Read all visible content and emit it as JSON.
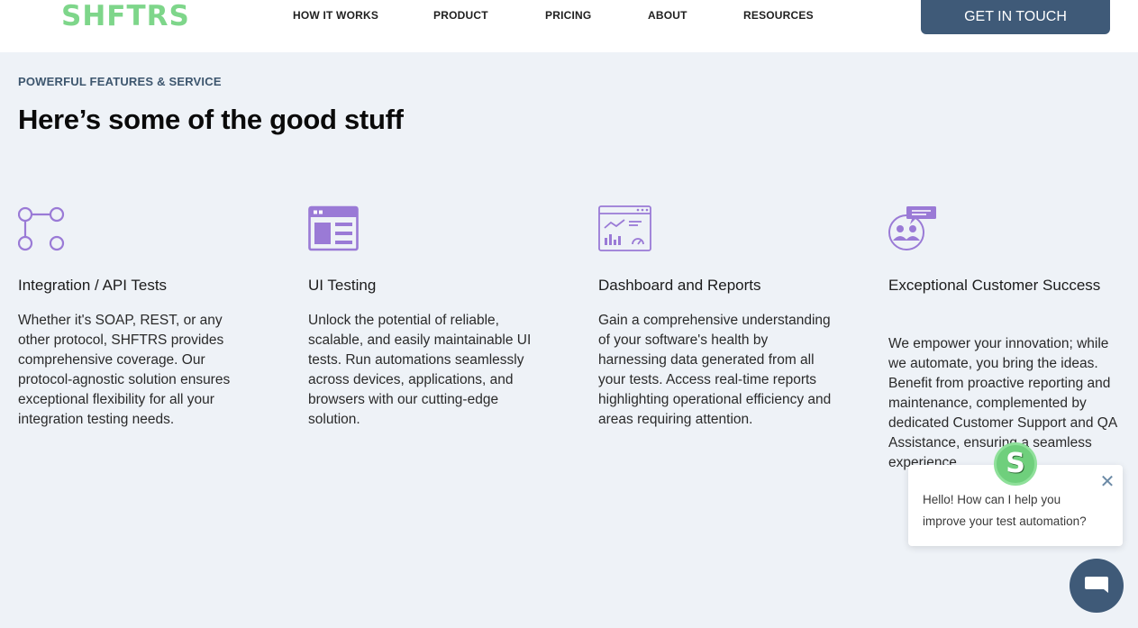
{
  "header": {
    "logo": "SHFTRS",
    "nav": [
      "HOW IT WORKS",
      "PRODUCT",
      "PRICING",
      "ABOUT",
      "RESOURCES"
    ],
    "cta": "GET IN TOUCH"
  },
  "section": {
    "eyebrow": "POWERFUL FEATURES & SERVICE",
    "headline": "Here’s some of the good stuff"
  },
  "features": [
    {
      "icon": "api-nodes-icon",
      "title": "Integration / API Tests",
      "description": "Whether it's SOAP, REST, or any other protocol, SHFTRS provides comprehensive coverage. Our protocol-agnostic solution ensures exceptional flexibility for all your integration testing needs."
    },
    {
      "icon": "ui-window-icon",
      "title": "UI Testing",
      "description": "Unlock the potential of reliable, scalable, and easily maintainable UI tests. Run automations seamlessly across devices, applications, and browsers with our cutting-edge solution."
    },
    {
      "icon": "dashboard-icon",
      "title": "Dashboard and Reports",
      "description": "Gain a comprehensive understanding of your software's health by harnessing data generated from all your tests. Access real-time reports highlighting operational efficiency and areas requiring attention."
    },
    {
      "icon": "customer-support-icon",
      "title": "Exceptional Customer Success",
      "description": "We empower your innovation; while we automate, you bring the ideas. Benefit from proactive reporting and maintenance, complemented by dedicated Customer Support and QA Assistance, ensuring a seamless experience."
    }
  ],
  "chat": {
    "message": "Hello! How can I help you improve your test automation?",
    "avatar_letter": "S"
  },
  "colors": {
    "brand_green": "#7ed68a",
    "accent_purple": "#9a7ad6",
    "cta_blue": "#3f5a78",
    "page_bg": "#eef2f7"
  }
}
